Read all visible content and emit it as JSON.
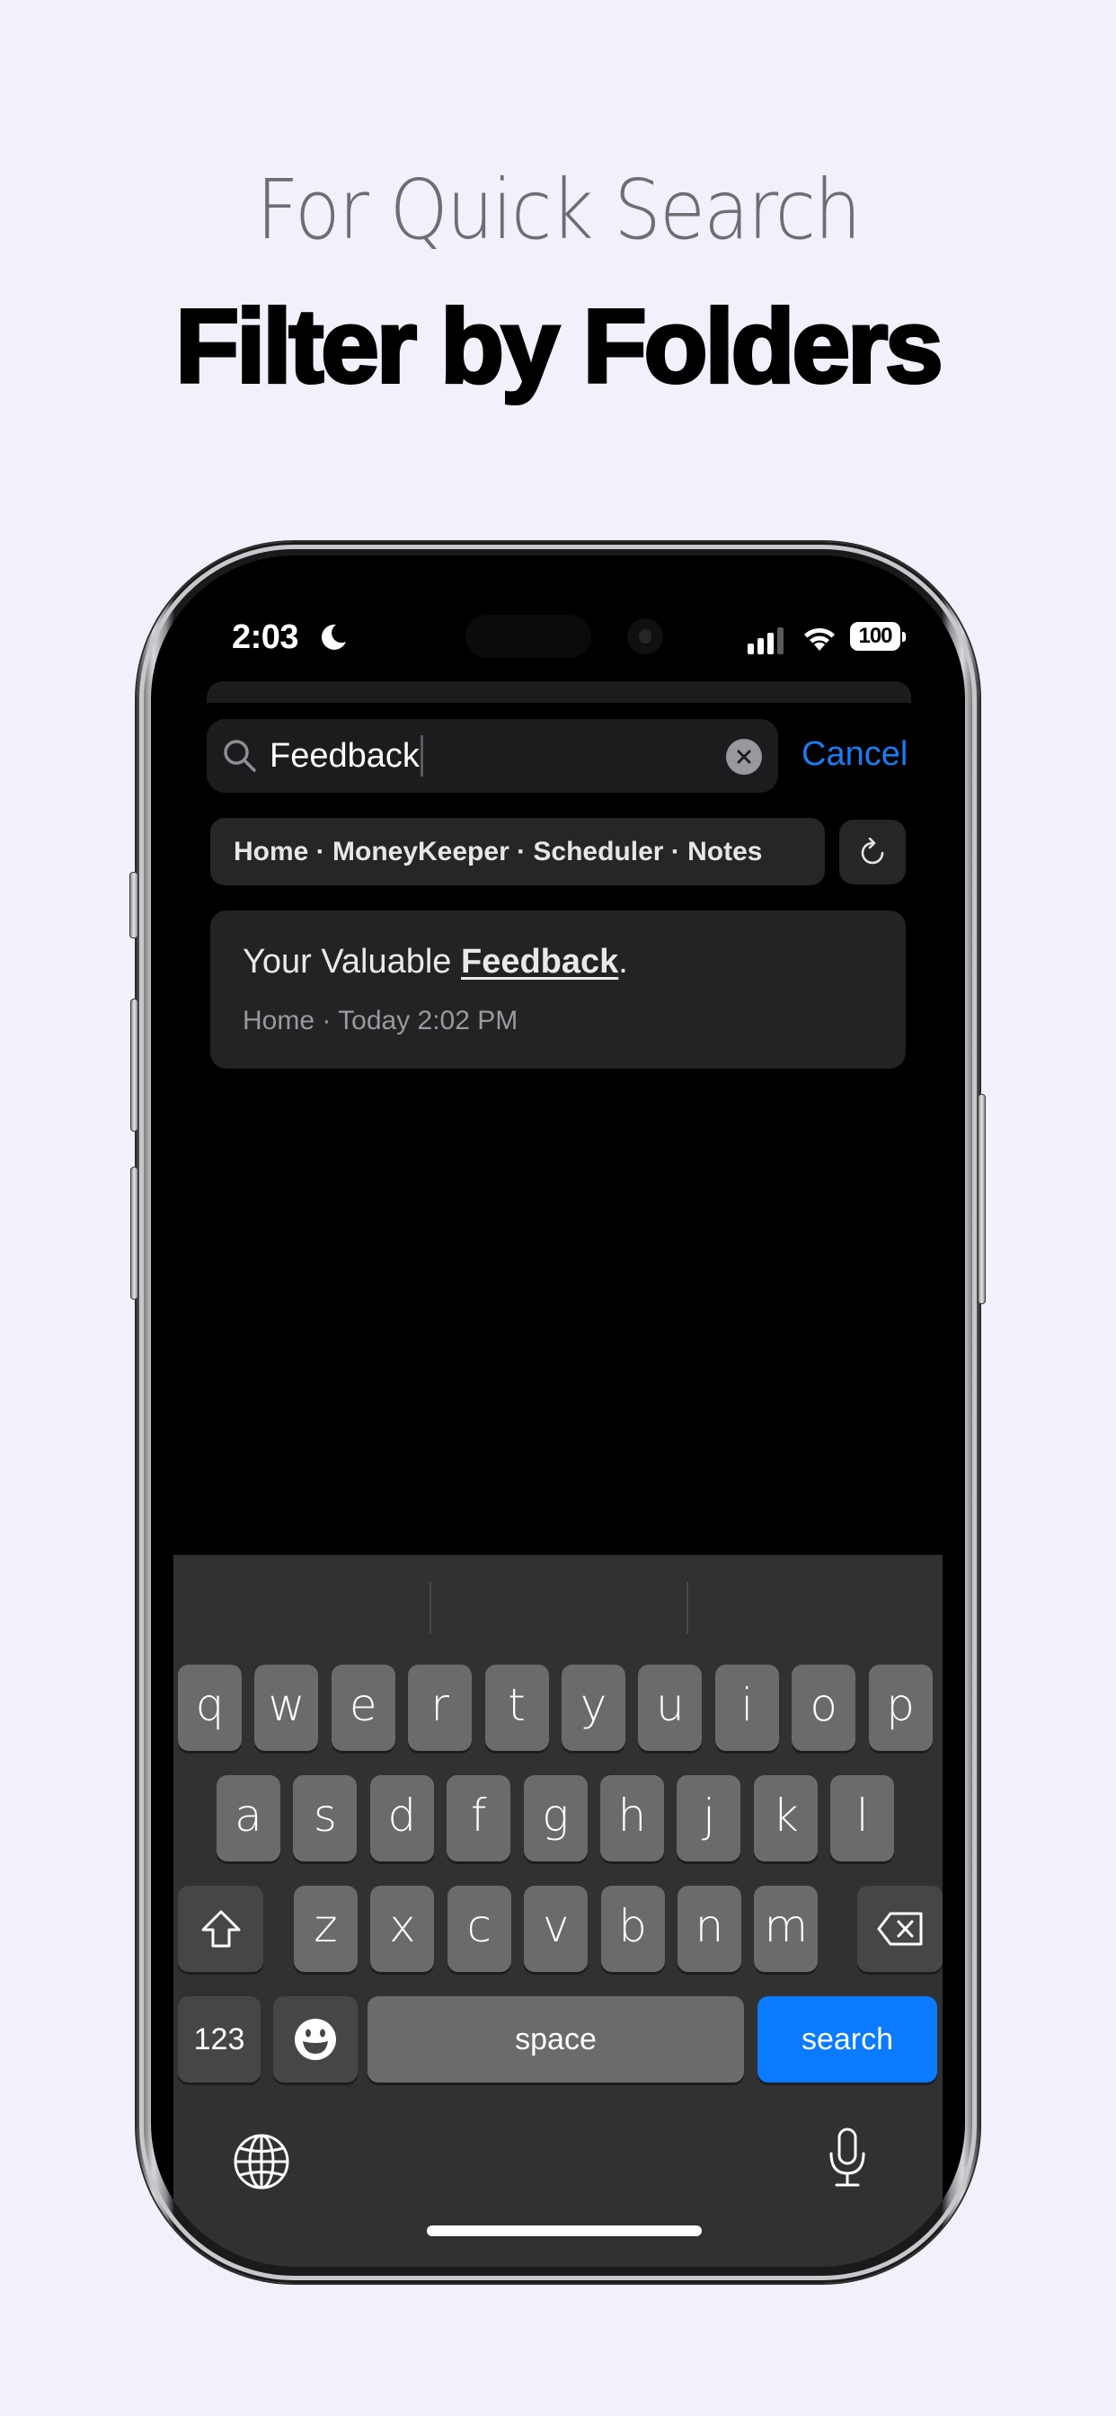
{
  "hero": {
    "subtitle": "For Quick Search",
    "title": "Filter by Folders"
  },
  "status_bar": {
    "time": "2:03",
    "focus_icon": "moon-icon",
    "battery": "100",
    "signal_icon": "cellular-signal-icon",
    "wifi_icon": "wifi-icon"
  },
  "search": {
    "value": "Feedback",
    "clear_icon": "clear-icon",
    "cancel_label": "Cancel"
  },
  "folder_filter": {
    "label": "Home · MoneyKeeper · Scheduler · Notes",
    "folders": [
      "Home",
      "MoneyKeeper",
      "Scheduler",
      "Notes"
    ],
    "refresh_icon": "refresh-icon"
  },
  "results": [
    {
      "title_prefix": "Your Valuable ",
      "title_match": "Feedback",
      "title_suffix": ".",
      "meta": "Home · Today 2:02 PM"
    }
  ],
  "keyboard": {
    "row1": [
      "q",
      "w",
      "e",
      "r",
      "t",
      "y",
      "u",
      "i",
      "o",
      "p"
    ],
    "row2": [
      "a",
      "s",
      "d",
      "f",
      "g",
      "h",
      "j",
      "k",
      "l"
    ],
    "row3": [
      "z",
      "x",
      "c",
      "v",
      "b",
      "n",
      "m"
    ],
    "numbers_label": "123",
    "space_label": "space",
    "return_label": "search"
  },
  "colors": {
    "accent": "#1b7cf3",
    "return_key": "#0a7aff",
    "background": "#f1f0fb"
  }
}
